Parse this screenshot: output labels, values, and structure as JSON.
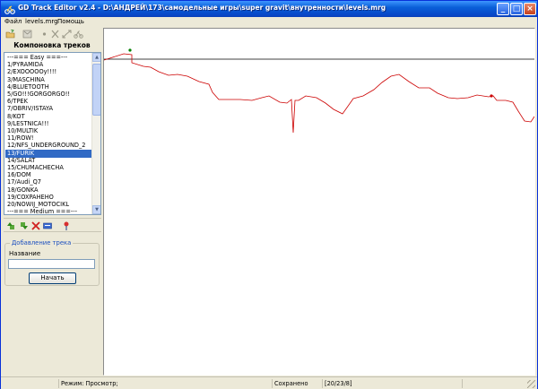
{
  "window": {
    "title": "GD Track Editor v2.4 - D:\\АНДРЕЙ\\173\\самодельные игры\\super gravit\\внутренности\\levels.mrg",
    "minimize_glyph": "_",
    "maximize_glyph": "□",
    "close_glyph": "×"
  },
  "menu": {
    "items": [
      "Файл",
      "levels.mrg",
      "Помощь"
    ]
  },
  "toolbar": {
    "icons": [
      "open-icon",
      "save-icon",
      "point-icon",
      "cut-icon",
      "scale-icon",
      "bike-icon"
    ]
  },
  "tracks": {
    "header": "Компоновка треков",
    "items": [
      "---=== Easy ===---",
      "1/PYRAMIDA",
      "2/EXOOOOOy!!!!",
      "3/MASCHINA",
      "4/BLUETOOTH",
      "5/GO!!!GORGORGO!!",
      "6/TPEK",
      "7/OBRIV/ISTAYA",
      "8/KOT",
      "9/LESTNICA!!!",
      "10/MULTIK",
      "11/ROW!",
      "12/NFS_UNDERGROUND_2",
      "13/FURIK",
      "14/SALAT",
      "15/CHUMACHECHA",
      "16/DOM",
      "17/Audi_Q7",
      "18/GONKA",
      "19/COXPAHEHO",
      "20/NOWIJ_MOTOCIKL",
      "---=== Medium ===---"
    ],
    "selected_index": 13,
    "scroll_up_glyph": "▲",
    "scroll_down_glyph": "▼",
    "tool_icons": [
      "move-up-icon",
      "move-down-icon",
      "delete-icon",
      "rename-icon",
      "test-track-icon"
    ]
  },
  "add_track": {
    "legend": "Добавление трека",
    "name_label": "Название",
    "name_value": "",
    "start_button": "Начать"
  },
  "editor": {
    "ground_color": "#cc0000",
    "start_color": "#008000"
  },
  "status": {
    "segments": [
      "",
      "Режим: Просмотр;",
      "Сохранено",
      "[20/23/8]",
      ""
    ]
  }
}
